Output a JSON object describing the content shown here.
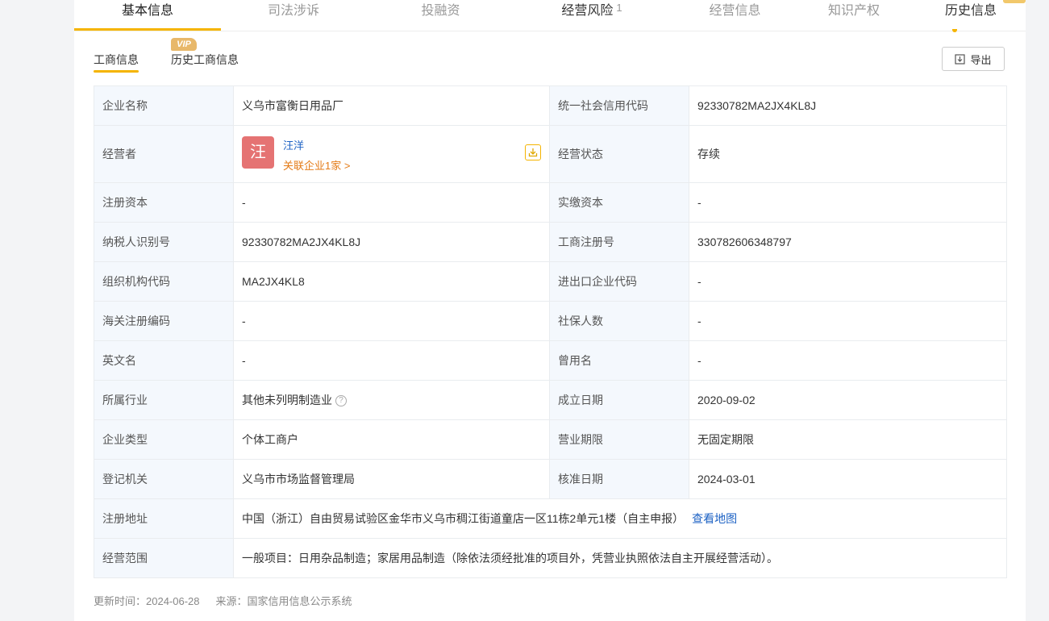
{
  "top_tabs": [
    {
      "label": "基本信息"
    },
    {
      "label": "司法涉诉"
    },
    {
      "label": "投融资"
    },
    {
      "label": "经营风险",
      "count": "1"
    },
    {
      "label": "经营信息"
    },
    {
      "label": "知识产权"
    },
    {
      "label": "历史信息"
    }
  ],
  "sub_tabs": {
    "business_info": "工商信息",
    "history_business_info": "历史工商信息",
    "vip_badge": "VIP"
  },
  "export_label": "导出",
  "table": {
    "company_name": {
      "label": "企业名称",
      "value": "义乌市富衡日用品厂"
    },
    "credit_code": {
      "label": "统一社会信用代码",
      "value": "92330782MA2JX4KL8J"
    },
    "operator": {
      "label": "经营者",
      "avatar": "汪",
      "name": "汪洋",
      "related": "关联企业1家 >"
    },
    "status": {
      "label": "经营状态",
      "value": "存续"
    },
    "reg_capital": {
      "label": "注册资本",
      "value": "-"
    },
    "paid_capital": {
      "label": "实缴资本",
      "value": "-"
    },
    "taxpayer_id": {
      "label": "纳税人识别号",
      "value": "92330782MA2JX4KL8J"
    },
    "reg_number": {
      "label": "工商注册号",
      "value": "330782606348797"
    },
    "org_code": {
      "label": "组织机构代码",
      "value": "MA2JX4KL8"
    },
    "import_export_code": {
      "label": "进出口企业代码",
      "value": "-"
    },
    "customs_code": {
      "label": "海关注册编码",
      "value": "-"
    },
    "insured_count": {
      "label": "社保人数",
      "value": "-"
    },
    "english_name": {
      "label": "英文名",
      "value": "-"
    },
    "former_name": {
      "label": "曾用名",
      "value": "-"
    },
    "industry": {
      "label": "所属行业",
      "value": "其他未列明制造业"
    },
    "founded_date": {
      "label": "成立日期",
      "value": "2020-09-02"
    },
    "company_type": {
      "label": "企业类型",
      "value": "个体工商户"
    },
    "business_term": {
      "label": "营业期限",
      "value": "无固定期限"
    },
    "registration_authority": {
      "label": "登记机关",
      "value": "义乌市市场监督管理局"
    },
    "approval_date": {
      "label": "核准日期",
      "value": "2024-03-01"
    },
    "address": {
      "label": "注册地址",
      "value": "中国（浙江）自由贸易试验区金华市义乌市稠江街道童店一区11栋2单元1楼（自主申报）",
      "map_link": "查看地图"
    },
    "scope": {
      "label": "经营范围",
      "value": "一般项目：日用杂品制造；家居用品制造（除依法须经批准的项目外，凭营业执照依法自主开展经营活动）。"
    }
  },
  "footer": {
    "updated": "更新时间：2024-06-28",
    "source": "来源：国家信用信息公示系统"
  },
  "colors": {
    "accent": "#f5b400",
    "link": "#1d62c4",
    "avatar_bg": "#e57373",
    "related_link": "#e47b17"
  },
  "icons": [
    "download-icon",
    "help-icon",
    "export-icon"
  ]
}
